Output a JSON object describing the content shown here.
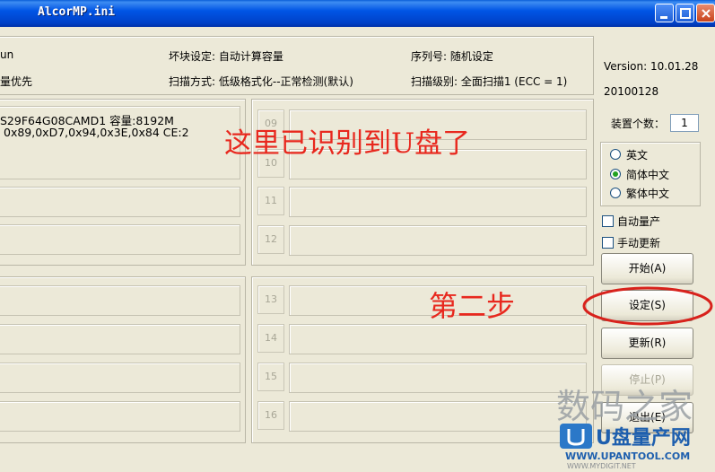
{
  "window": {
    "title": "AlcorMP.ini"
  },
  "info": {
    "left_top": "un",
    "left_bottom": "量优先",
    "bad_block": "坏块设定: 自动计算容量",
    "serial": "序列号: 随机设定",
    "scan_method": "扫描方式: 低级格式化--正常检测(默认)",
    "scan_level": "扫描级别: 全面扫描1 (ECC = 1)"
  },
  "version": {
    "version": "Version: 10.01.28",
    "date": "20100128"
  },
  "device_count": {
    "label": "装置个数：",
    "value": "1"
  },
  "languages": [
    {
      "label": "英文",
      "checked": false
    },
    {
      "label": "简体中文",
      "checked": true
    },
    {
      "label": "繁体中文",
      "checked": false
    }
  ],
  "checks": [
    {
      "label": "自动量产",
      "checked": false
    },
    {
      "label": "手动更新",
      "checked": false
    }
  ],
  "slot1": {
    "line1": "S29F64G08CAMD1 容量:8192M",
    "line2": "0x89,0xD7,0x94,0x3E,0x84  CE:2"
  },
  "ports": [
    "09",
    "10",
    "11",
    "12",
    "13",
    "14",
    "15",
    "16"
  ],
  "buttons": {
    "start": "开始(A)",
    "settings": "设定(S)",
    "update": "更新(R)",
    "stop": "停止(P)",
    "exit": "退出(E)"
  },
  "annotations": {
    "recognized": "这里已识别到U盘了",
    "step2": "第二步"
  },
  "watermark": {
    "chinese": "数码之家",
    "brand": "U盘量产网",
    "url": "WWW.UPANTOOL.COM",
    "url2": "WWW.MYDIGIT.NET"
  }
}
